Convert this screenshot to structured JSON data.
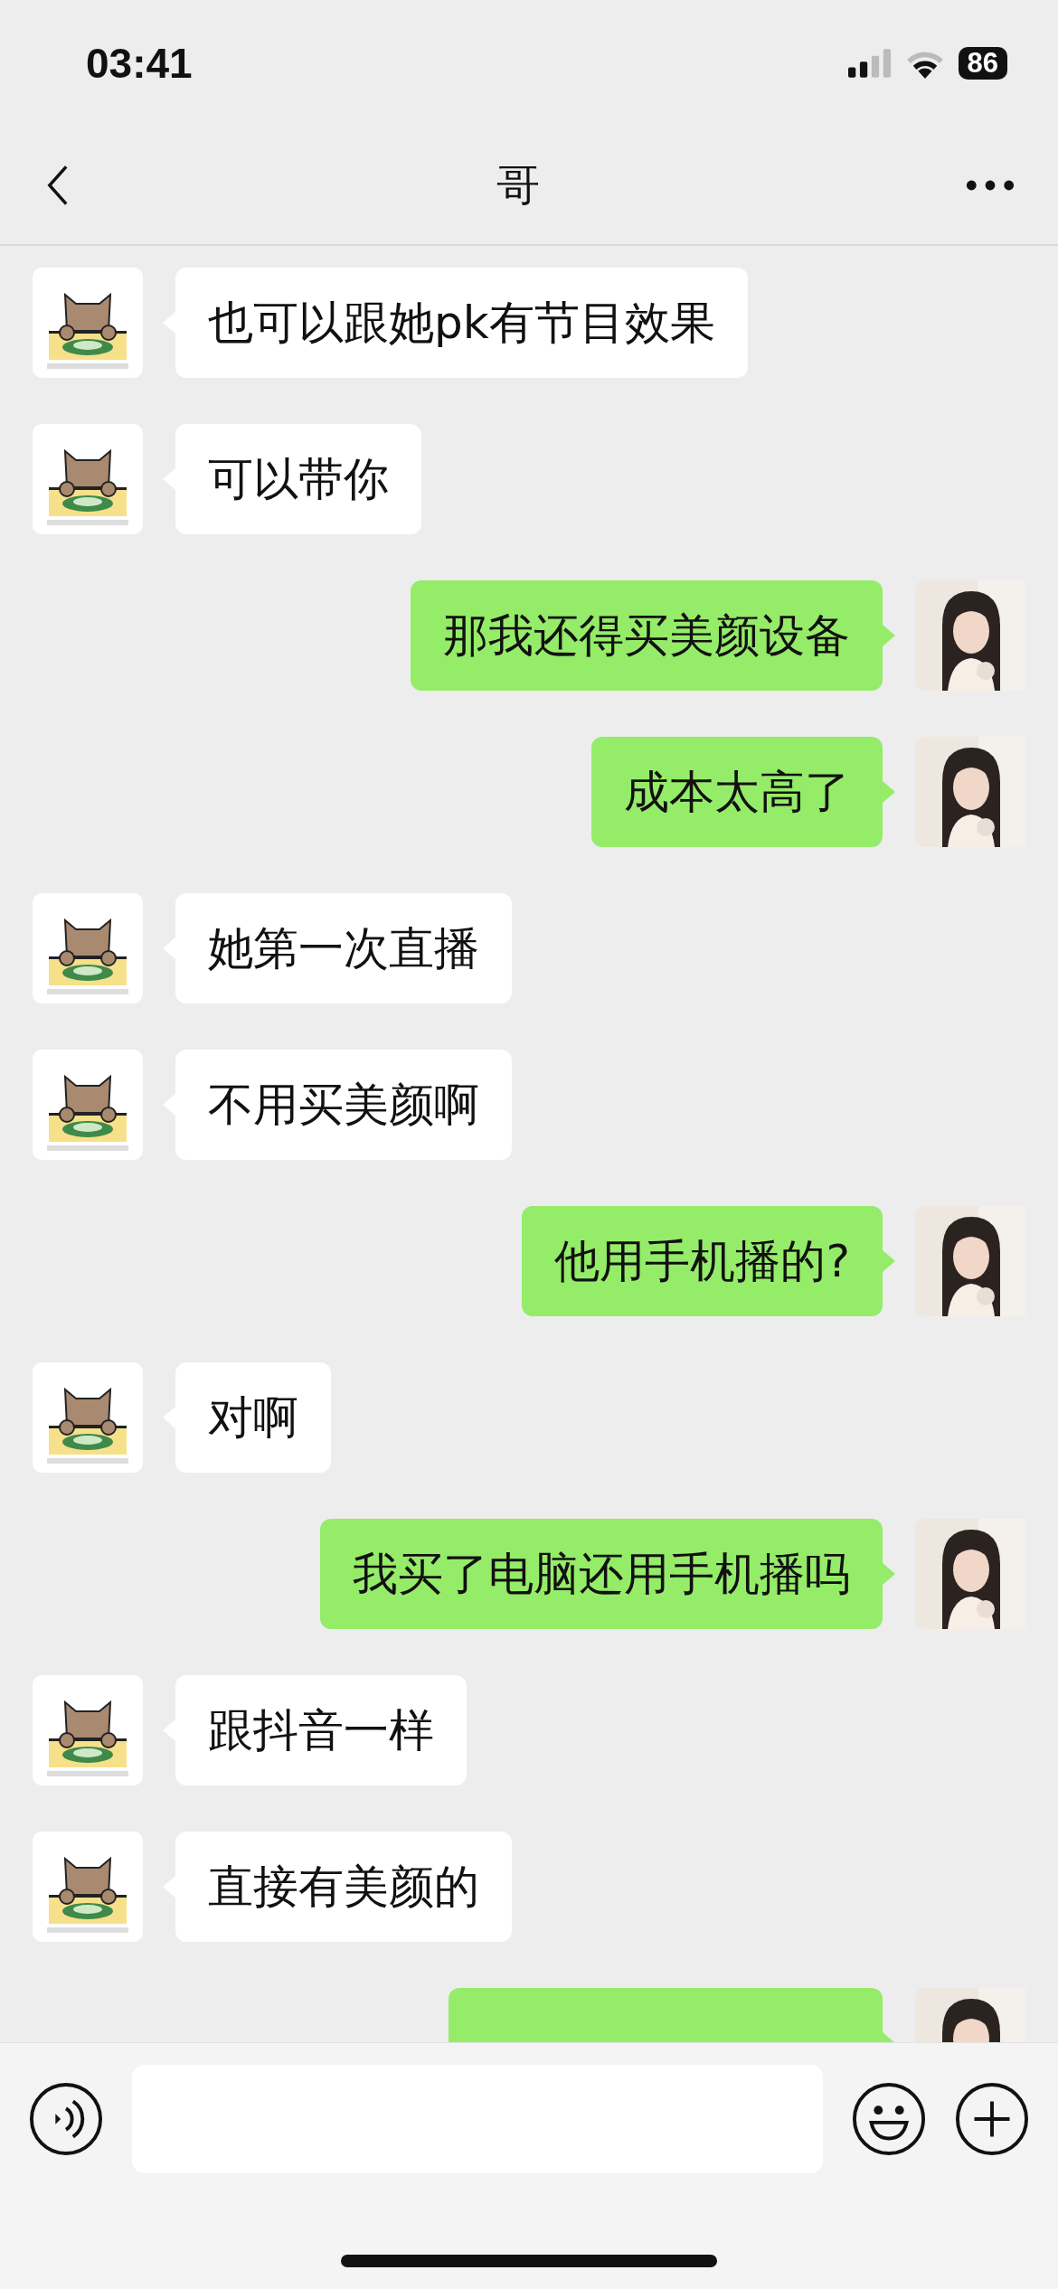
{
  "status_bar": {
    "time": "03:41",
    "battery": "86"
  },
  "nav_bar": {
    "title": "哥"
  },
  "messages": [
    {
      "kind": "incoming",
      "text": "也可以跟她pk有节目效果"
    },
    {
      "kind": "incoming",
      "text": "可以带你"
    },
    {
      "kind": "outgoing",
      "text": "那我还得买美颜设备"
    },
    {
      "kind": "outgoing",
      "text": "成本太高了"
    },
    {
      "kind": "incoming",
      "text": "她第一次直播"
    },
    {
      "kind": "incoming",
      "text": "不用买美颜啊"
    },
    {
      "kind": "outgoing",
      "text": "他用手机播的?"
    },
    {
      "kind": "incoming",
      "text": "对啊"
    },
    {
      "kind": "outgoing",
      "text": "我买了电脑还用手机播吗"
    },
    {
      "kind": "incoming",
      "text": "跟抖音一样"
    },
    {
      "kind": "incoming",
      "text": "直接有美颜的"
    },
    {
      "kind": "outgoing"
    }
  ]
}
